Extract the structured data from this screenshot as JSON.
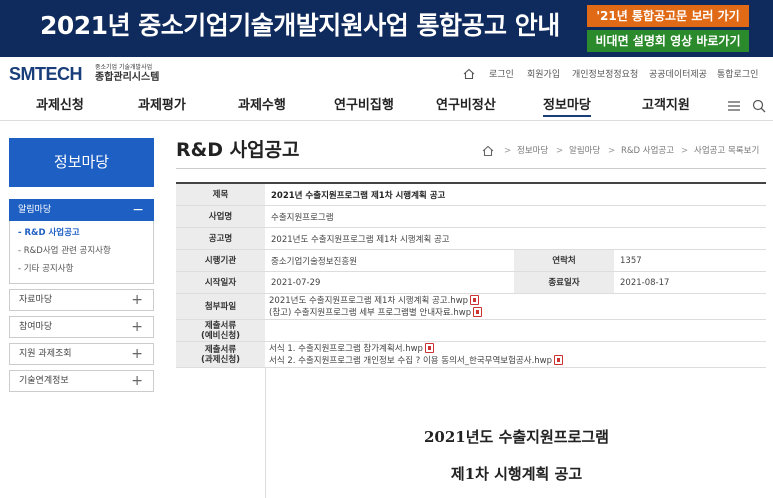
{
  "banner": {
    "title": "2021년 중소기업기술개발지원사업 통합공고 안내",
    "btn_notice": "'21년 통합공고문 보러 가기",
    "btn_video": "비대면 설명회 영상 바로가기",
    "orange": "#e06a16",
    "green": "#2b8a2b",
    "bg": "#0f2a5c"
  },
  "logo": {
    "main": "SMTECH",
    "sub1": "중소기업 기술개발사업",
    "sub2": "종합관리시스템"
  },
  "util_links": [
    "로그인",
    "회원가입",
    "개인정보정정요청",
    "공공데이터제공",
    "통합로그인"
  ],
  "nav": [
    "과제신청",
    "과제평가",
    "과제수행",
    "연구비집행",
    "연구비정산",
    "정보마당",
    "고객지원"
  ],
  "nav_active": "정보마당",
  "sidebar": {
    "title": "정보마당",
    "active_menu": "알림마당",
    "active_toggle": "−",
    "subs": [
      "- R&D 사업공고",
      "- R&D사업 관련 공지사항",
      "- 기타 공지사항"
    ],
    "menus": [
      "자료마당",
      "참여마당",
      "지원 과제조회",
      "기술연계정보"
    ],
    "plus": "+"
  },
  "page": {
    "title": "R&D 사업공고",
    "breadcrumb": [
      "정보마당",
      "알림마당",
      "R&D 사업공고",
      "사업공고 목록보기"
    ],
    "sep": ">"
  },
  "detail": {
    "title_label": "제목",
    "title_value": "2021년 수출지원프로그램 제1차 시행계획 공고",
    "biz_label": "사업명",
    "biz_value": "수출지원프로그램",
    "notice_label": "공고명",
    "notice_value": "2021년도 수출지원프로그램 제1차 시행계획 공고",
    "agency_label": "시행기관",
    "agency_value": "중소기업기술정보진흥원",
    "contact_label": "연락처",
    "contact_value": "1357",
    "start_label": "시작일자",
    "start_value": "2021-07-29",
    "end_label": "종료일자",
    "end_value": "2021-08-17",
    "attach_label": "첨부파일",
    "attachments": [
      "2021년도 수출지원프로그램 제1차 시행계획 공고.hwp",
      "(참고) 수출지원프로그램 세부 프로그램별 안내자료.hwp"
    ],
    "pre_label_1": "제출서류",
    "pre_label_2": "(예비신청)",
    "task_label_1": "제출서류",
    "task_label_2": "(과제신청)",
    "task_files": [
      "서식 1. 수출지원프로그램 참가계획서.hwp",
      "서식 2. 수출지원프로그램 개인정보 수집 ? 이용 동의서_한국무역보험공사.hwp"
    ]
  },
  "document": {
    "line1": "2021년도 수출지원프로그램",
    "line2": "제1차 시행계획 공고"
  }
}
